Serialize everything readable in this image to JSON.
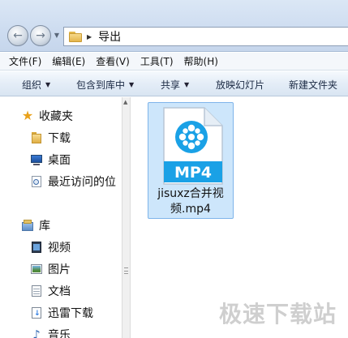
{
  "address": {
    "path": "导出"
  },
  "menubar": {
    "items": [
      "文件(F)",
      "编辑(E)",
      "查看(V)",
      "工具(T)",
      "帮助(H)"
    ]
  },
  "commandbar": {
    "organize": "组织",
    "include_in_library": "包含到库中",
    "share": "共享",
    "slideshow": "放映幻灯片",
    "new_folder": "新建文件夹"
  },
  "navpane": {
    "favorites": "收藏夹",
    "downloads": "下载",
    "desktop": "桌面",
    "recent": "最近访问的位",
    "libraries": "库",
    "videos": "视频",
    "pictures": "图片",
    "documents": "文档",
    "thunder_downloads": "迅雷下载",
    "music": "音乐"
  },
  "content": {
    "file": {
      "badge": "MP4",
      "name": "jisuxz合并视频.mp4",
      "selected": true
    }
  },
  "watermark": "极速下载站",
  "colors": {
    "selection_fill": "#cde6fb",
    "selection_border": "#7eb4ea",
    "mp4_blue": "#1aa1e6",
    "favorites_star": "#e9a11a"
  }
}
